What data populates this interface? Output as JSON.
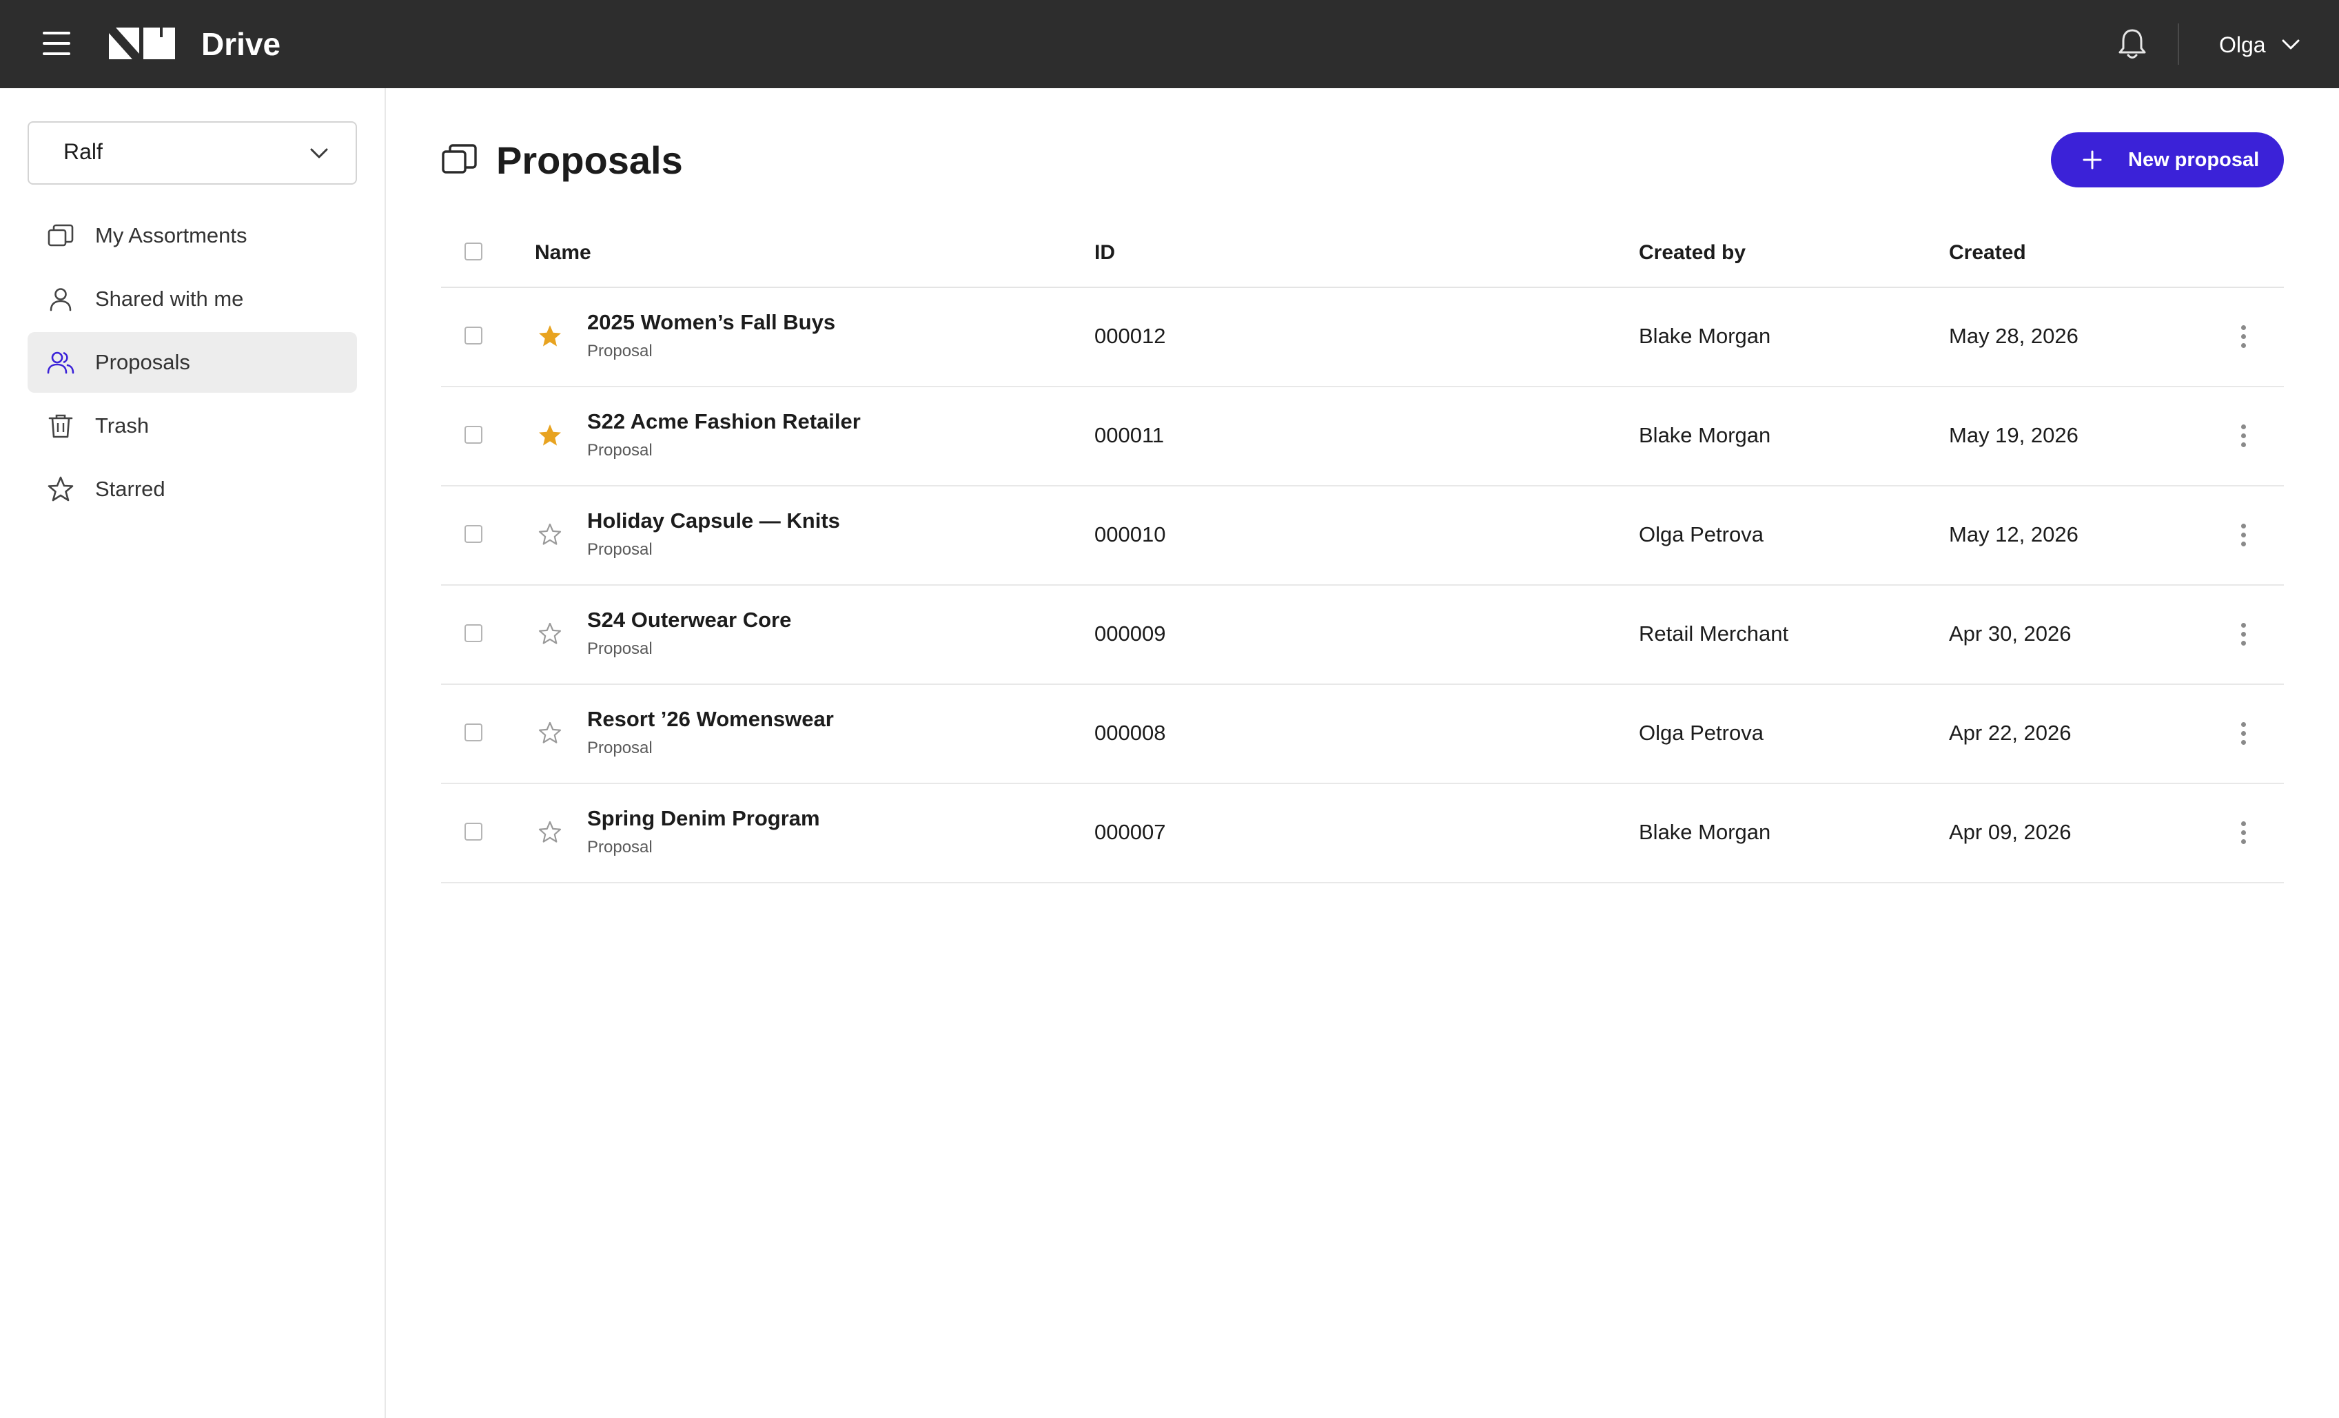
{
  "app": {
    "title": "Drive"
  },
  "topbar": {
    "user_name": "Olga"
  },
  "sidebar": {
    "workspace": "Ralf",
    "items": [
      {
        "label": "My Assortments",
        "icon": "assortments-icon"
      },
      {
        "label": "Shared with me",
        "icon": "person-icon"
      },
      {
        "label": "Proposals",
        "icon": "people-icon",
        "active": true
      },
      {
        "label": "Trash",
        "icon": "trash-icon"
      },
      {
        "label": "Starred",
        "icon": "star-outline-icon"
      }
    ]
  },
  "page": {
    "title": "Proposals",
    "new_button_label": "New proposal"
  },
  "table": {
    "headers": {
      "name": "Name",
      "id": "ID",
      "created_by": "Created by",
      "created": "Created"
    },
    "rows": [
      {
        "name": "2025 Women’s Fall Buys",
        "type": "Proposal",
        "id": "000012",
        "created_by": "Blake Morgan",
        "created": "May 28, 2026",
        "starred": true
      },
      {
        "name": "S22 Acme Fashion Retailer",
        "type": "Proposal",
        "id": "000011",
        "created_by": "Blake Morgan",
        "created": "May 19, 2026",
        "starred": true
      },
      {
        "name": "Holiday Capsule — Knits",
        "type": "Proposal",
        "id": "000010",
        "created_by": "Olga Petrova",
        "created": "May 12, 2026",
        "starred": false
      },
      {
        "name": "S24 Outerwear Core",
        "type": "Proposal",
        "id": "000009",
        "created_by": "Retail Merchant",
        "created": "Apr 30, 2026",
        "starred": false
      },
      {
        "name": "Resort ’26 Womenswear",
        "type": "Proposal",
        "id": "000008",
        "created_by": "Olga Petrova",
        "created": "Apr 22, 2026",
        "starred": false
      },
      {
        "name": "Spring Denim Program",
        "type": "Proposal",
        "id": "000007",
        "created_by": "Blake Morgan",
        "created": "Apr 09, 2026",
        "starred": false
      }
    ]
  },
  "colors": {
    "topbar_bg": "#2d2d2d",
    "accent": "#3b22d8",
    "star_filled": "#e8a320",
    "active_nav_bg": "#ededed"
  }
}
